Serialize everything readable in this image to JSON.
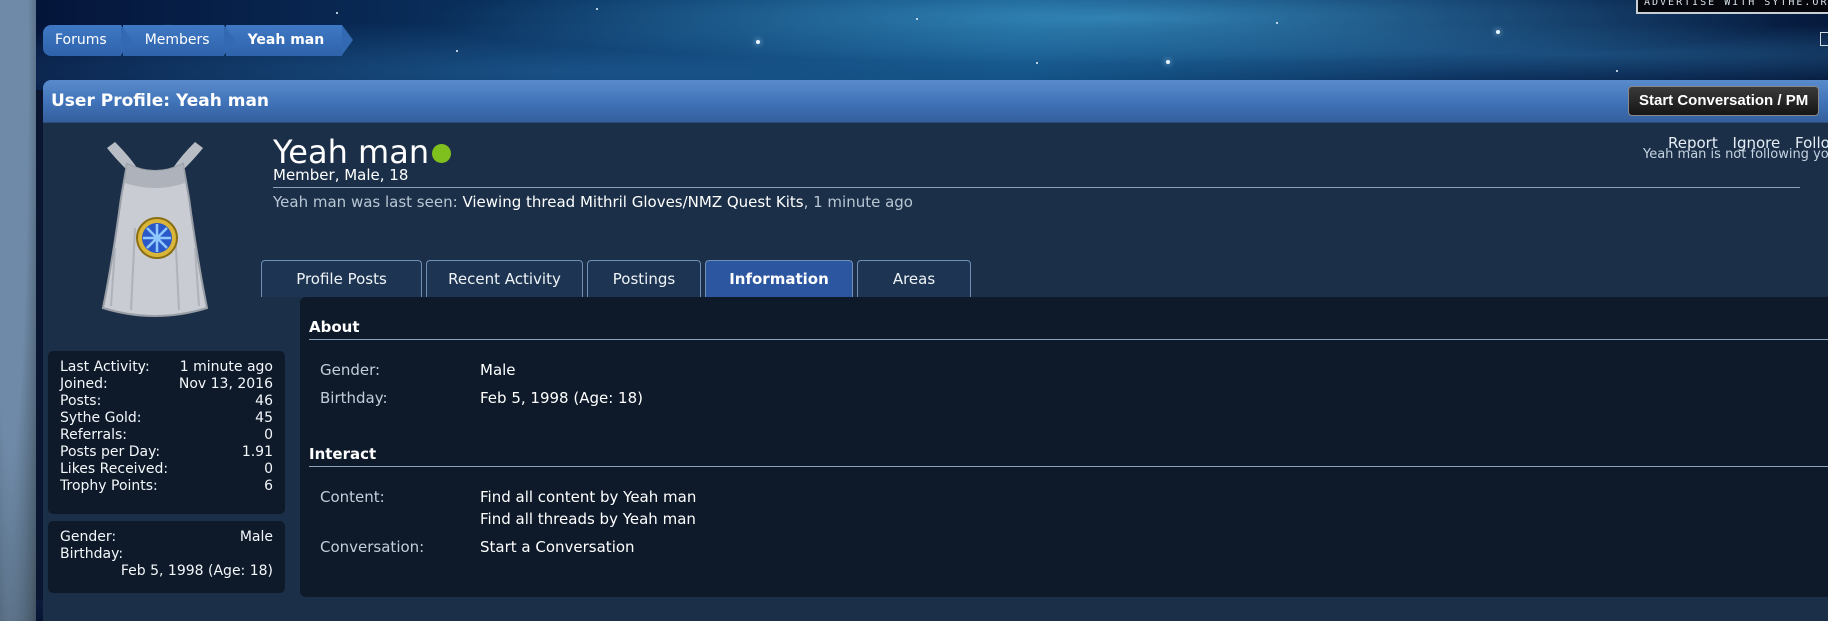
{
  "page": {
    "title": "User Profile: Yeah man"
  },
  "colors": {
    "accent": "#2c56a0",
    "online": "#7fbf1e",
    "panel": "#1b3048",
    "content": "#0e1a2a"
  },
  "ad_banner": {
    "text": "ADVERTISE WITH SYTHE.ORG"
  },
  "breadcrumb": [
    {
      "label": "Forums"
    },
    {
      "label": "Members"
    },
    {
      "label": "Yeah man"
    }
  ],
  "header": {
    "title": "User Profile: Yeah man",
    "start_conversation": "Start Conversation / PM"
  },
  "profile": {
    "username": "Yeah man",
    "status": "online",
    "user_title": "Member, Male, 18",
    "last_seen_prefix": "Yeah man was last seen:",
    "last_seen_action": "Viewing thread",
    "last_seen_thread": "Mithril Gloves/NMZ Quest Kits",
    "last_seen_time": ", 1 minute ago",
    "links": {
      "report": "Report",
      "ignore": "Ignore",
      "follow": "Follow"
    },
    "follow_note": "Yeah man is not following you"
  },
  "stats": [
    {
      "label": "Last Activity:",
      "value": "1 minute ago"
    },
    {
      "label": "Joined:",
      "value": "Nov 13, 2016"
    },
    {
      "label": "Posts:",
      "value": "46"
    },
    {
      "label": "Sythe Gold:",
      "value": "45"
    },
    {
      "label": "Referrals:",
      "value": "0"
    },
    {
      "label": "Posts per Day:",
      "value": "1.91"
    },
    {
      "label": "Likes Received:",
      "value": "0"
    },
    {
      "label": "Trophy Points:",
      "value": "6"
    }
  ],
  "sidebar_info": {
    "gender_label": "Gender:",
    "gender": "Male",
    "birthday_label": "Birthday:",
    "birthday": "Feb 5, 1998 (Age: 18)"
  },
  "tabs": [
    {
      "label": "Profile Posts"
    },
    {
      "label": "Recent Activity"
    },
    {
      "label": "Postings"
    },
    {
      "label": "Information",
      "active": true
    },
    {
      "label": "Areas"
    }
  ],
  "about": {
    "title": "About",
    "gender_label": "Gender:",
    "gender": "Male",
    "birthday_label": "Birthday:",
    "birthday": "Feb 5, 1998 (Age: 18)"
  },
  "interact": {
    "title": "Interact",
    "content_label": "Content:",
    "find_content": "Find all content by Yeah man",
    "find_threads": "Find all threads by Yeah man",
    "conversation_label": "Conversation:",
    "start_conversation": "Start a Conversation"
  }
}
